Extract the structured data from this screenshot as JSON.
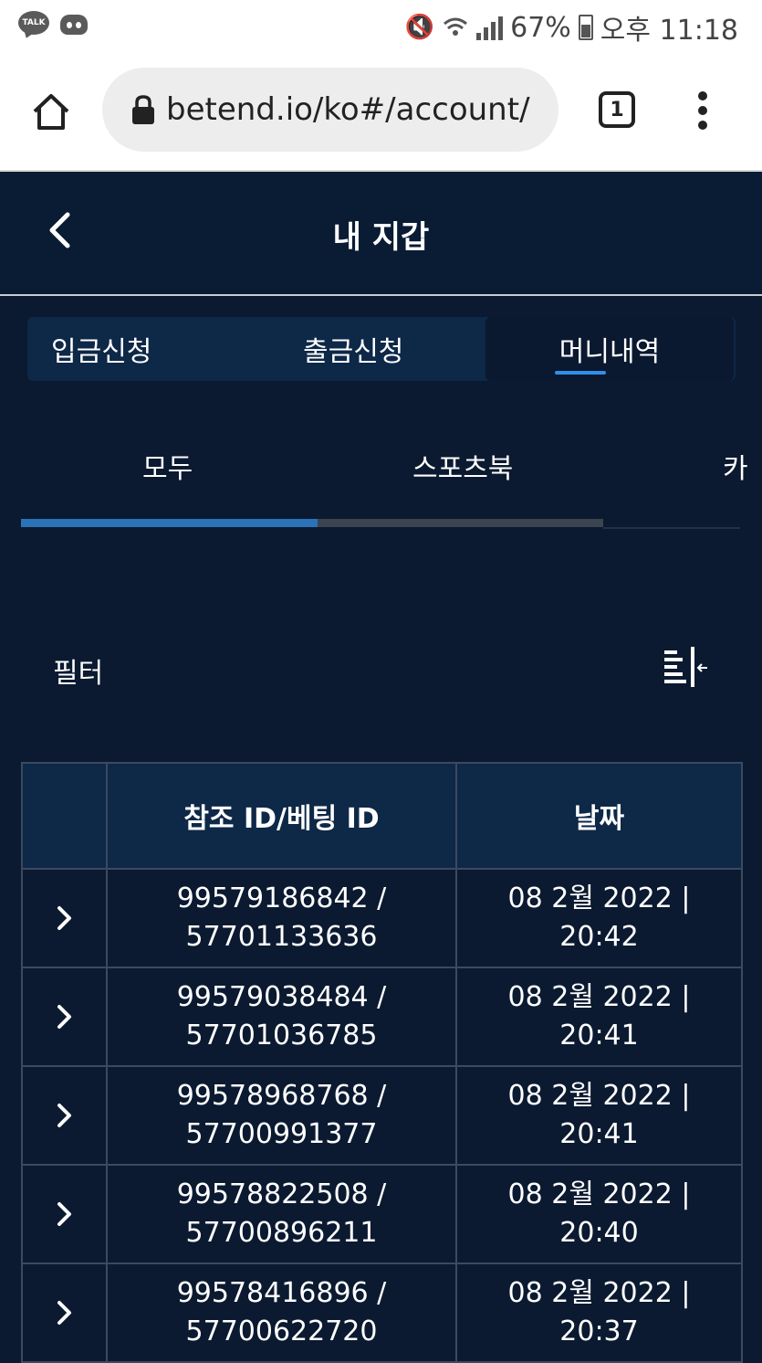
{
  "status_bar": {
    "talk_label": "TALK",
    "battery": "67%",
    "time": "오후 11:18"
  },
  "browser": {
    "url": "betend.io/ko#/account/",
    "tab_count": "1"
  },
  "header": {
    "title": "내 지갑"
  },
  "main_tabs": [
    {
      "label": "입금신청",
      "active": false
    },
    {
      "label": "출금신청",
      "active": false
    },
    {
      "label": "머니내역",
      "active": true
    }
  ],
  "sub_tabs": [
    {
      "label": "모두",
      "active": true
    },
    {
      "label": "스포츠북",
      "active": false
    },
    {
      "label": "카",
      "active": false
    }
  ],
  "filter": {
    "label": "필터"
  },
  "table": {
    "columns": [
      "",
      "참조 ID/베팅 ID",
      "날짜"
    ],
    "rows": [
      {
        "ref_id": "99579186842 /",
        "bet_id": "57701133636",
        "date": "08 2월 2022 |",
        "time": "20:42"
      },
      {
        "ref_id": "99579038484 /",
        "bet_id": "57701036785",
        "date": "08 2월 2022 |",
        "time": "20:41"
      },
      {
        "ref_id": "99578968768 /",
        "bet_id": "57700991377",
        "date": "08 2월 2022 |",
        "time": "20:41"
      },
      {
        "ref_id": "99578822508 /",
        "bet_id": "57700896211",
        "date": "08 2월 2022 |",
        "time": "20:40"
      },
      {
        "ref_id": "99578416896 /",
        "bet_id": "57700622720",
        "date": "08 2월 2022 |",
        "time": "20:37"
      }
    ]
  },
  "colors": {
    "background": "#0b1a30",
    "accent": "#2f8fe8",
    "progress": "#2a73b8",
    "table_header": "#0e2847"
  }
}
